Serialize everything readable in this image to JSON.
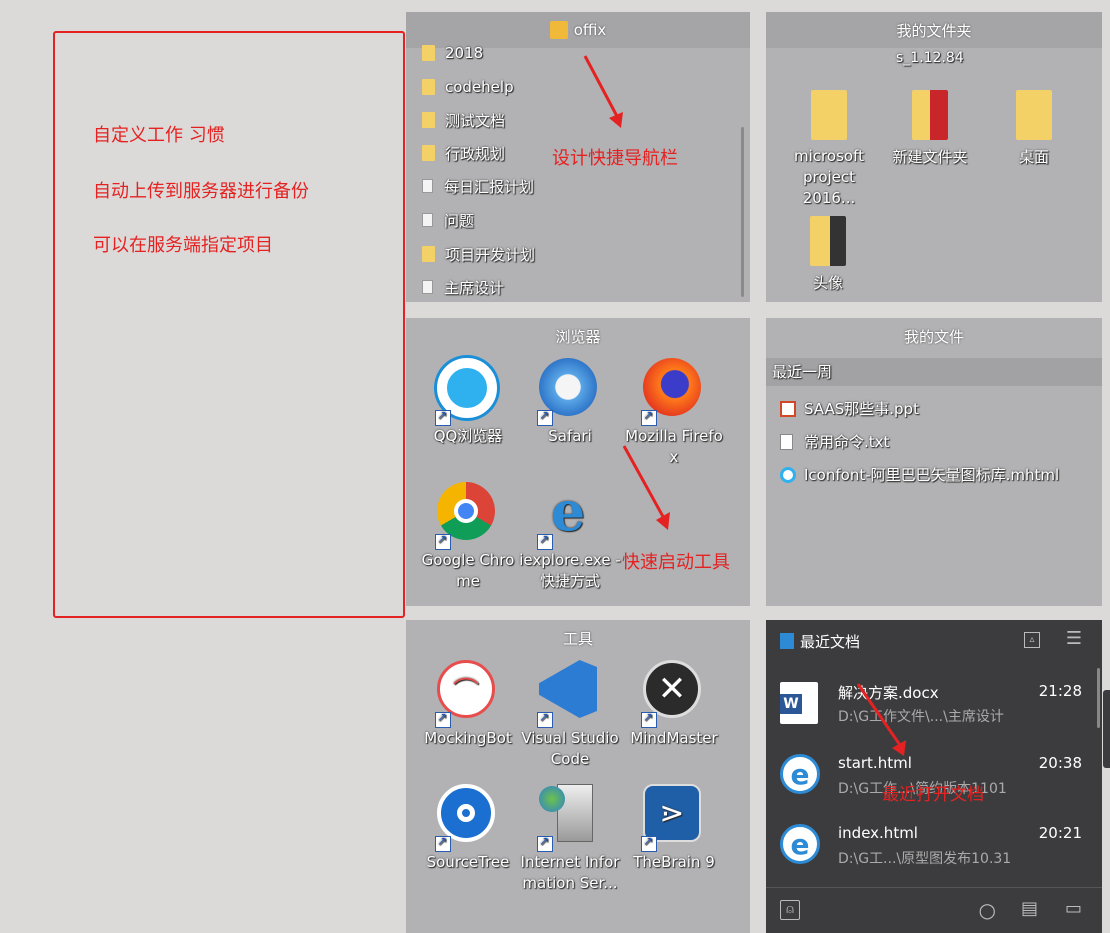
{
  "annotations": {
    "left_box_lines": [
      "自定义工作 习惯",
      "自动上传到服务器进行备份",
      "可以在服务端指定项目"
    ],
    "nav_note": "设计快捷导航栏",
    "launch_note": "快速启动工具",
    "docs_note": "最近打开文档"
  },
  "offix": {
    "title": "offix",
    "items": [
      {
        "label": "2018",
        "icon": "folder"
      },
      {
        "label": "codehelp",
        "icon": "folder"
      },
      {
        "label": "测试文档",
        "icon": "folder"
      },
      {
        "label": "行政规划",
        "icon": "folder"
      },
      {
        "label": "每日汇报计划",
        "icon": "file"
      },
      {
        "label": "问题",
        "icon": "file"
      },
      {
        "label": "项目开发计划",
        "icon": "folder"
      },
      {
        "label": "主席设计",
        "icon": "file"
      }
    ]
  },
  "my_folder": {
    "title": "我的文件夹",
    "partial_label": "s_1.12.84",
    "items": [
      {
        "label": "microsoft project 2016..."
      },
      {
        "label": "新建文件夹"
      },
      {
        "label": "桌面"
      },
      {
        "label": "头像"
      }
    ]
  },
  "browser": {
    "title": "浏览器",
    "apps": [
      {
        "label": "QQ浏览器",
        "icon": "qq-browser-icon"
      },
      {
        "label": "Safari",
        "icon": "safari-icon"
      },
      {
        "label": "Mozilla Firefox",
        "icon": "firefox-icon"
      },
      {
        "label": "Google Chrome",
        "icon": "chrome-icon"
      },
      {
        "label": "iexplore.exe - 快捷方式",
        "icon": "ie-icon"
      }
    ]
  },
  "my_files": {
    "title": "我的文件",
    "group": "最近一周",
    "files": [
      {
        "label": "SAAS那些事.ppt",
        "icon": "ppt-icon"
      },
      {
        "label": "常用命令.txt",
        "icon": "txt-icon"
      },
      {
        "label": "Iconfont-阿里巴巴矢量图标库.mhtml",
        "icon": "browser-file-icon"
      }
    ]
  },
  "tools": {
    "title": "工具",
    "apps": [
      {
        "label": "MockingBot",
        "icon": "mockingbot-icon"
      },
      {
        "label": "Visual Studio Code",
        "icon": "vscode-icon"
      },
      {
        "label": "MindMaster",
        "icon": "mindmaster-icon"
      },
      {
        "label": "SourceTree",
        "icon": "sourcetree-icon"
      },
      {
        "label": "Internet Information Ser...",
        "icon": "iis-icon"
      },
      {
        "label": "TheBrain 9",
        "icon": "thebrain-icon"
      }
    ]
  },
  "recent": {
    "title": "最近文档",
    "docs": [
      {
        "name": "解决方案.docx",
        "path": "D:\\G工作文件\\...\\主席设计",
        "time": "21:28",
        "icon": "word-icon"
      },
      {
        "name": "start.html",
        "path": "D:\\G工作...\\简约版本1101",
        "time": "20:38",
        "icon": "ie-icon"
      },
      {
        "name": "index.html",
        "path": "D:\\G工...\\原型图发布10.31",
        "time": "20:21",
        "icon": "ie-icon"
      }
    ]
  },
  "colors": {
    "annotation_red": "#e52222",
    "panel_gray": "#b2b2b4",
    "recent_dark": "#3c3c3e"
  }
}
